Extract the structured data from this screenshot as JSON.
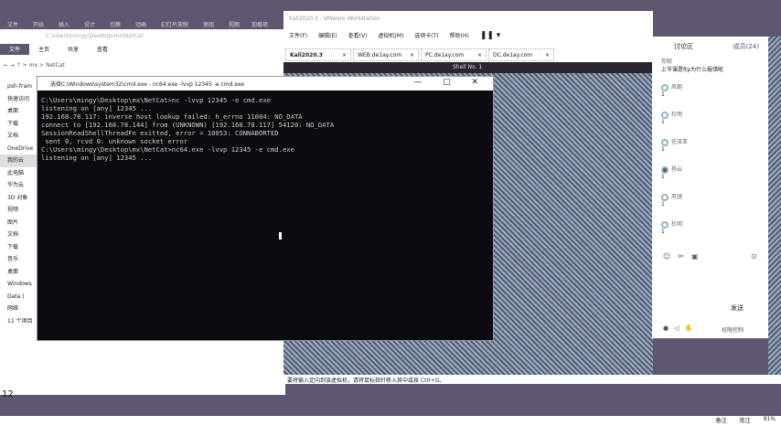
{
  "ppt": {
    "tabs": [
      "文件",
      "开始",
      "插入",
      "设计",
      "切换",
      "动画",
      "幻灯片放映",
      "审阅",
      "视图",
      "加载项"
    ],
    "slide_num": "12",
    "status": [
      "备注",
      "批注",
      "91%"
    ]
  },
  "explorer": {
    "address": "C:\\Users\\mingy\\Desktop\\mx\\NetCat",
    "tabs": [
      "文件",
      "主页",
      "共享",
      "查看"
    ],
    "nav": "← → ↑  > mx > NetCat",
    "sidebar": [
      "psh-fram",
      "快速访问",
      "桌面",
      "下载",
      "文档",
      "OneDrive",
      "我的云",
      "此电脑",
      "华为云",
      "3D 对象",
      "视频",
      "图片",
      "文档",
      "下载",
      "音乐",
      "桌面",
      "Windows",
      "Data (",
      "网络",
      "11 个项目"
    ]
  },
  "vmware": {
    "title": "Kali2020.3 - VMware Workstation",
    "menu": [
      "文件(F)",
      "编辑(E)",
      "查看(V)",
      "虚拟机(M)",
      "选项卡(T)",
      "帮助(H)"
    ],
    "tabs": [
      "Kali2020.3",
      "WEB.de1ay.com",
      "PC.de1ay.com",
      "DC.de1ay.com"
    ],
    "shell_tab": "Shell No. 1",
    "status": "要将输入定向到该虚拟机，请将鼠标指针移入其中或按 Ctrl+G。"
  },
  "cmd": {
    "title": "选择C:\\Windows\\system32\\cmd.exe - nc64.exe  -lvvp 12345 -e cmd.exe",
    "controls": "— □ ✕",
    "lines": [
      "C:\\Users\\mingy\\Desktop\\mx\\NetCat>nc -lvvp 12345 -e cmd.exe",
      "listening on [any] 12345 ...",
      "192.168.78.117: inverse host lookup failed: h_errno 11004: NO_DATA",
      "connect to [192.168.78.144] from (UNKNOWN) [192.168.78.117] 54120: NO_DATA",
      "SessionReadShellThreadFn exitted, error = 10053: CONNABORTED",
      " sent 0, rcvd 0: unknown socket error",
      "",
      "C:\\Users\\mingy\\Desktop\\mx\\NetCat>nc64.exe -lvvp 12345 -e cmd.exe",
      "listening on [any] 12345 ..."
    ]
  },
  "chat": {
    "title": "讨论区",
    "members": "成员(24)",
    "messages": [
      {
        "name": "你就",
        "text": "上节课是ftp为什么报错呢"
      },
      {
        "name": "风朝",
        "text": "1"
      },
      {
        "name": "杜明",
        "text": "1"
      },
      {
        "name": "任泽亚",
        "text": "1"
      },
      {
        "name": "杨云",
        "text": "1"
      },
      {
        "name": "风驰",
        "text": "1"
      },
      {
        "name": "杜明",
        "text": "1"
      }
    ],
    "send": "发送",
    "manage": "权限控制"
  }
}
